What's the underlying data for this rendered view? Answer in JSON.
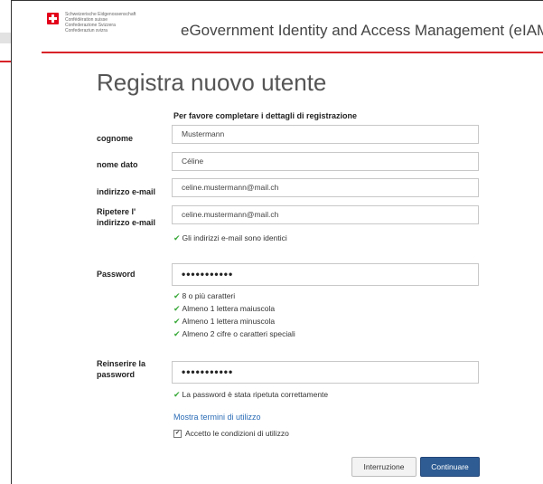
{
  "header": {
    "confederation_lines": [
      "Schweizerische Eidgenossenschaft",
      "Confédération suisse",
      "Confederazione Svizzera",
      "Confederaziun svizra"
    ],
    "app_title": "eGovernment Identity and Access Management (eIAM)"
  },
  "page": {
    "title": "Registra nuovo utente",
    "subhead": "Per favore completare i dettagli di registrazione"
  },
  "form": {
    "surname": {
      "label": "cognome",
      "value": "Mustermann"
    },
    "given_name": {
      "label": "nome dato",
      "value": "Céline"
    },
    "email": {
      "label": "indirizzo e-mail",
      "value": "celine.mustermann@mail.ch"
    },
    "email_repeat": {
      "label_line1": "Ripetere l'",
      "label_line2": "indirizzo e-mail",
      "value": "celine.mustermann@mail.ch"
    },
    "email_match_msg": "Gli indirizzi e-mail sono identici",
    "password": {
      "label": "Password",
      "value": "•••••••••••"
    },
    "password_rules": [
      "8 o più caratteri",
      "Almeno 1 lettera maiuscola",
      "Almeno 1 lettera minuscola",
      "Almeno 2 cifre o caratteri speciali"
    ],
    "password_repeat": {
      "label_line1": "Reinserire la",
      "label_line2": "password",
      "value": "•••••••••••"
    },
    "password_match_msg": "La password è stata ripetuta correttamente",
    "terms_link": "Mostra termini di utilizzo",
    "accept_terms": {
      "label": "Accetto le condizioni di utilizzo",
      "checked": true
    }
  },
  "buttons": {
    "cancel": "Interruzione",
    "continue": "Continuare"
  },
  "colors": {
    "swiss_red": "#d8232a",
    "check_green": "#3aa93a",
    "link_blue": "#2b6cb6",
    "primary_button": "#2e5c93"
  }
}
